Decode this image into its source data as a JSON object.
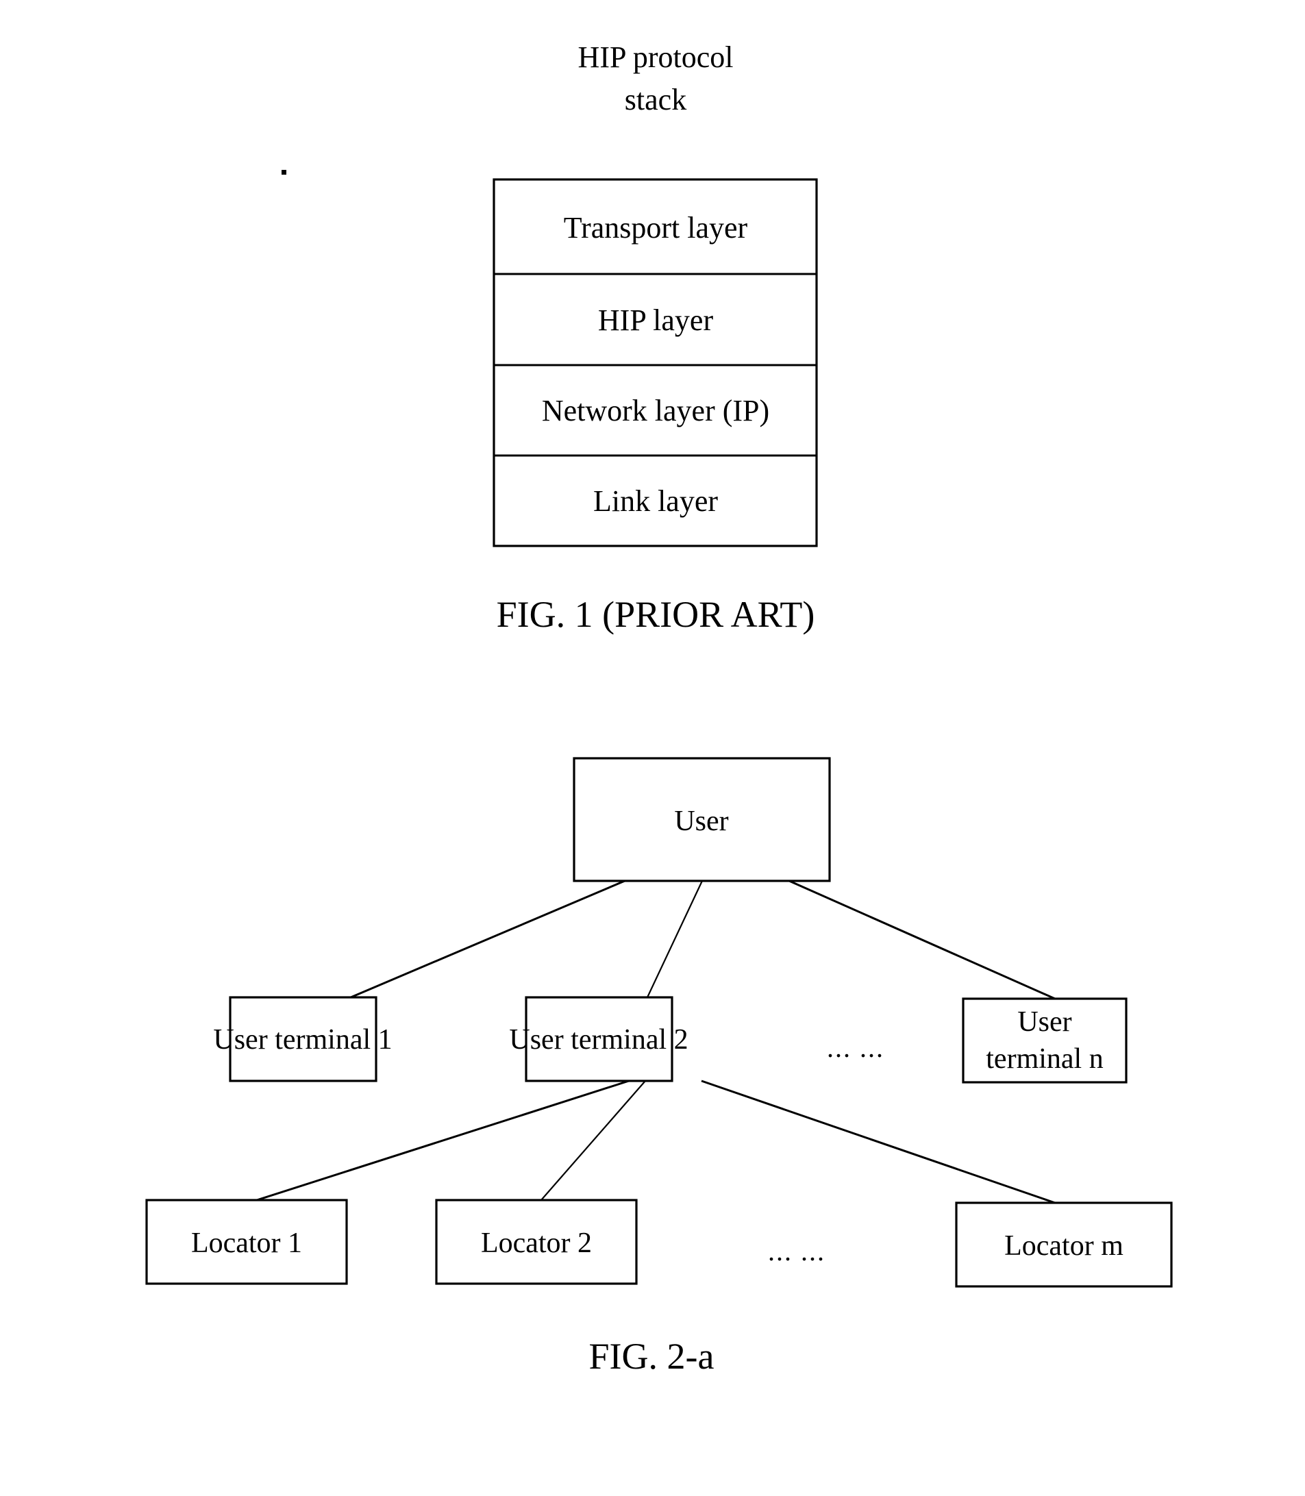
{
  "document": {
    "kind": "patent-figure-sheet",
    "background_color": "#ffffff",
    "ink_color": "#000000"
  },
  "figure1": {
    "title_line1": "HIP protocol",
    "title_line2": "stack",
    "caption": "FIG. 1 (PRIOR ART)",
    "stack_layers": [
      {
        "label": "Transport layer"
      },
      {
        "label": "HIP layer"
      },
      {
        "label": "Network layer (IP)"
      },
      {
        "label": "Link layer"
      }
    ]
  },
  "figure2a": {
    "caption": "FIG. 2-a",
    "root": {
      "label": "User"
    },
    "terminals": [
      {
        "label": "User terminal 1"
      },
      {
        "label": "User terminal 2"
      },
      {
        "label_line1": "User",
        "label_line2": "terminal n"
      }
    ],
    "terminal_ellipsis": "...  ...",
    "locators": [
      {
        "label": "Locator 1"
      },
      {
        "label": "Locator 2"
      },
      {
        "label": "Locator m"
      }
    ],
    "locator_ellipsis": "...  ..."
  }
}
